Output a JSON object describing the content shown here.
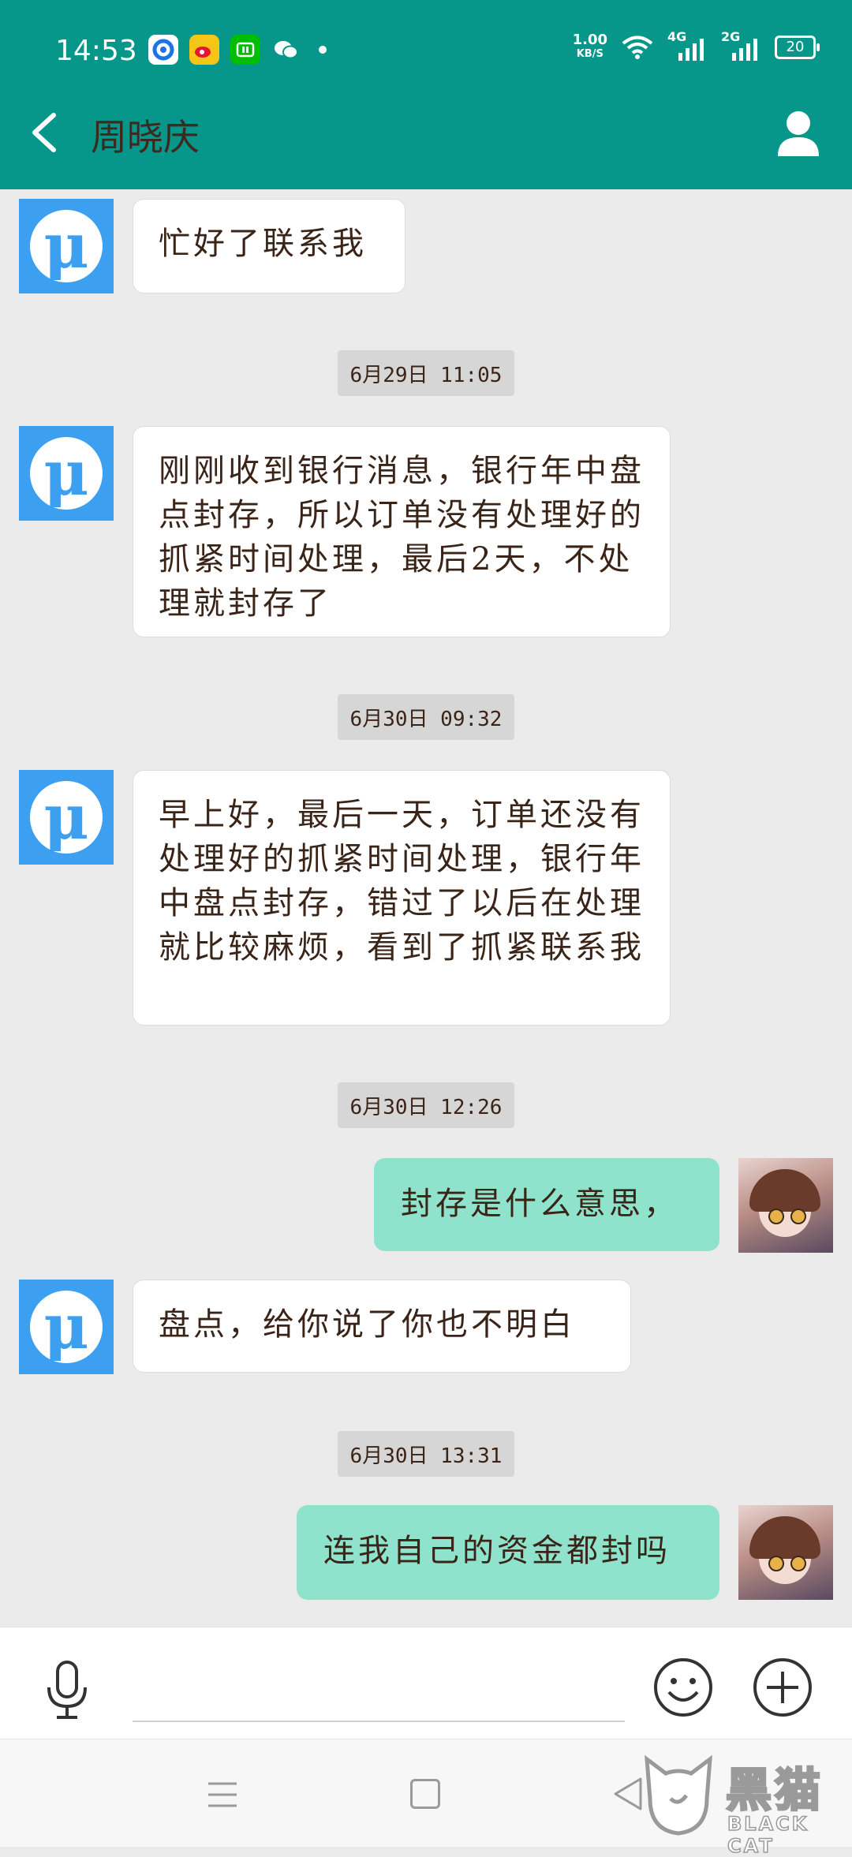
{
  "status_bar": {
    "time": "14:53",
    "speed_value": "1.00",
    "speed_unit": "KB/S",
    "net1": "4G",
    "net2": "2G",
    "battery": "20"
  },
  "header": {
    "title": "周晓庆"
  },
  "messages": [
    {
      "type": "left",
      "text": "忙好了联系我"
    },
    {
      "type": "time",
      "text": "6月29日 11:05"
    },
    {
      "type": "left",
      "text": "刚刚收到银行消息，银行年中盘点封存，所以订单没有处理好的抓紧时间处理，最后2天，不处理就封存了"
    },
    {
      "type": "time",
      "text": "6月30日 09:32"
    },
    {
      "type": "left",
      "text": "早上好，最后一天，订单还没有处理好的抓紧时间处理，银行年中盘点封存，错过了以后在处理就比较麻烦，看到了抓紧联系我"
    },
    {
      "type": "time",
      "text": "6月30日 12:26"
    },
    {
      "type": "right",
      "text": "封存是什么意思，"
    },
    {
      "type": "left",
      "text": "盘点，给你说了你也不明白"
    },
    {
      "type": "time",
      "text": "6月30日 13:31"
    },
    {
      "type": "right",
      "text": "连我自己的资金都封吗"
    }
  ],
  "input": {
    "placeholder": ""
  },
  "watermark": {
    "title": "黑猫",
    "subtitle": "BLACK CAT"
  },
  "colors": {
    "header_bg": "#06978a",
    "sent_bubble": "#8fe3cc",
    "received_bubble": "#ffffff",
    "avatar_blue": "#3d9ff0"
  }
}
